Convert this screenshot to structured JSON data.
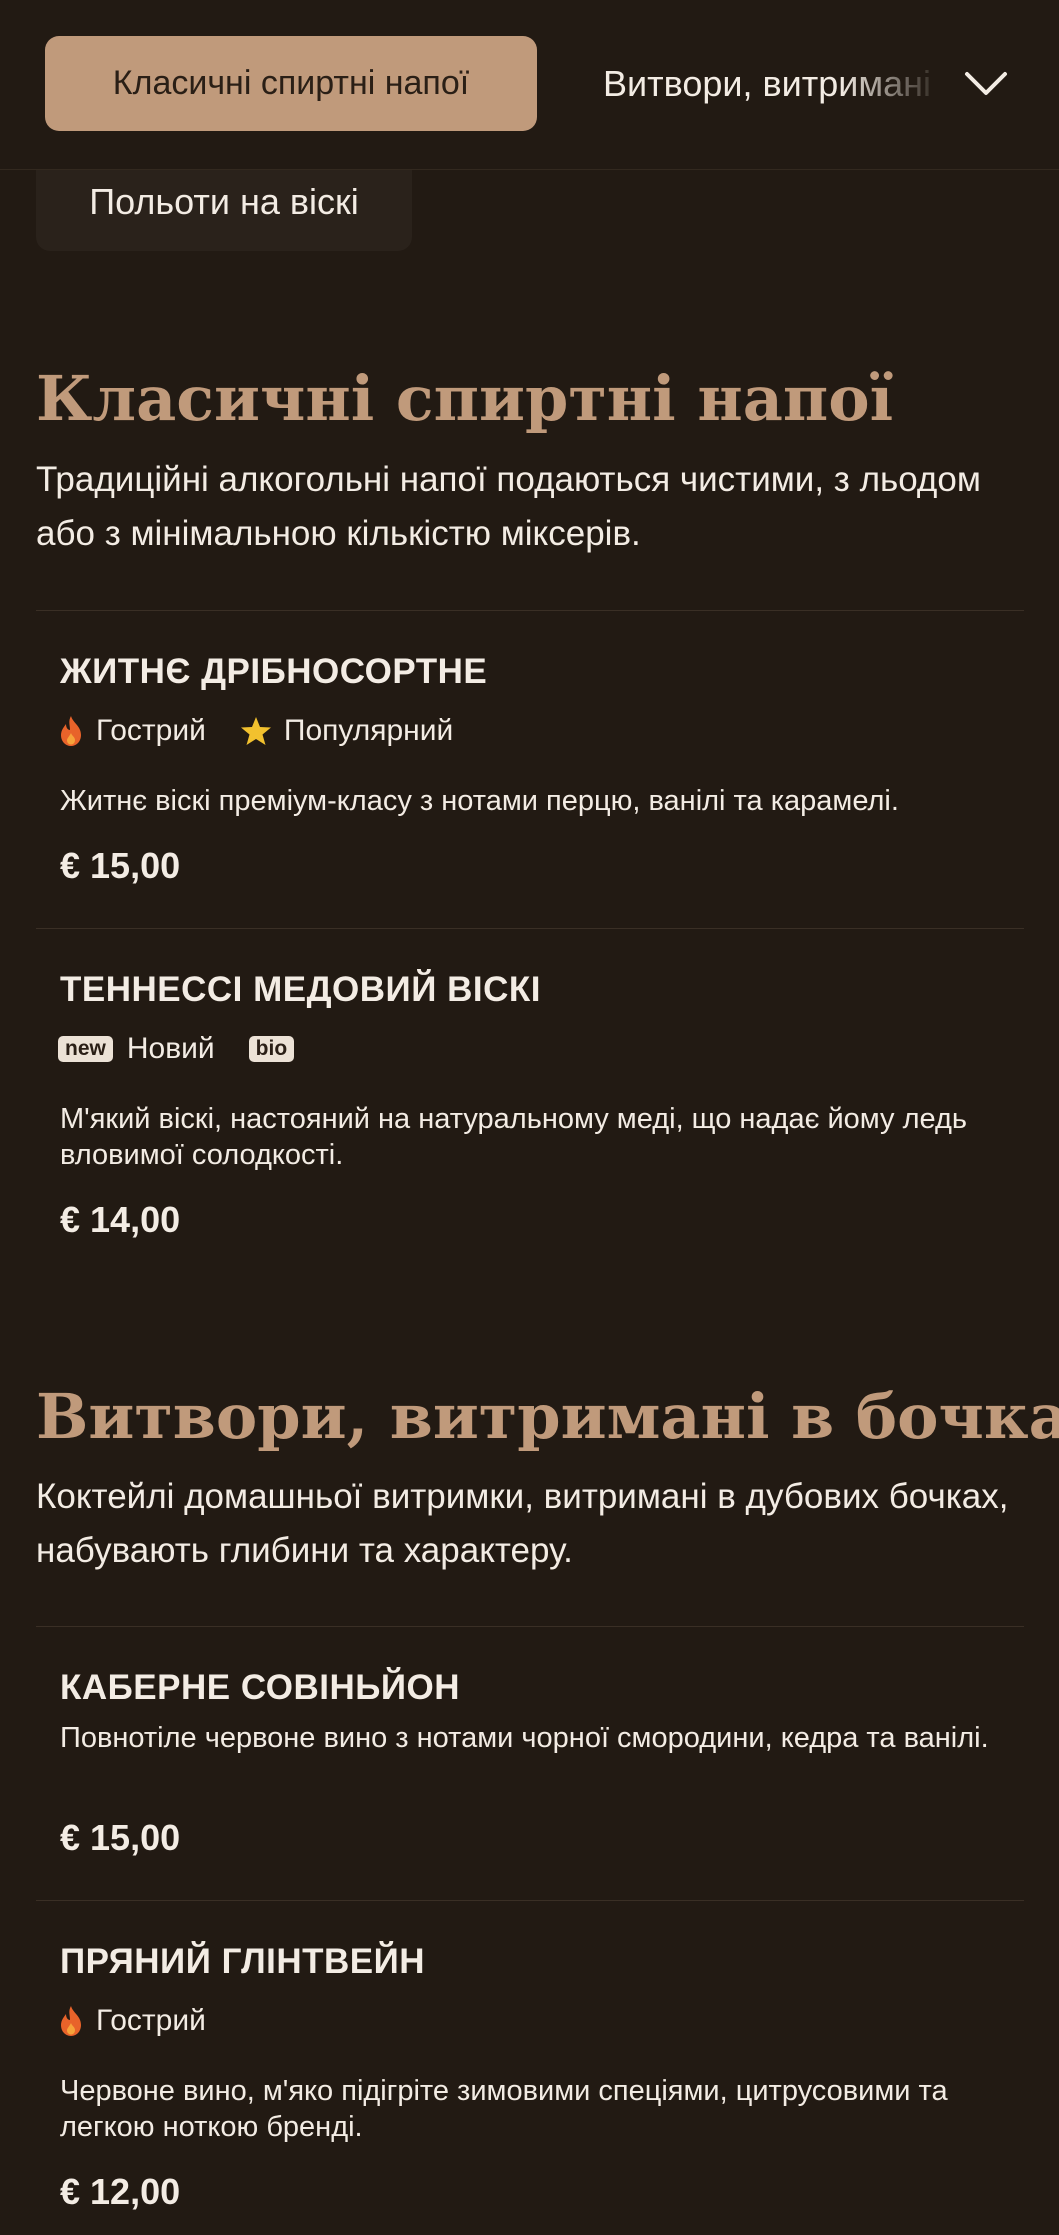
{
  "nav": {
    "active_chip": "Класичні спиртні напої",
    "next_chip": "Витвори, витримані в бочках",
    "row2_chip": "Польоти на віскі"
  },
  "colors": {
    "background": "#221a13",
    "accent": "#c09a7b",
    "text": "#f3ece4",
    "flame": "#e8632a",
    "star": "#f2c12e"
  },
  "sections": [
    {
      "title": "Класичні спиртні напої",
      "description": "Традиційні алкогольні напої подаються чистими, з льодом або з мінімальною кількістю міксерів.",
      "items": [
        {
          "name": "ЖИТНЄ ДРІБНОСОРТНЕ",
          "tags": [
            {
              "icon": "flame-icon",
              "label": "Гострий"
            },
            {
              "icon": "star-icon",
              "label": "Популярний"
            }
          ],
          "description": "Житнє віскі преміум-класу з нотами перцю, ванілі та карамелі.",
          "price": "€ 15,00"
        },
        {
          "name": "ТЕННЕССІ МЕДОВИЙ ВІСКІ",
          "tags": [
            {
              "badge": "new",
              "label": "Новий"
            },
            {
              "badge": "bio"
            }
          ],
          "description": "М'який віскі, настояний на натуральному меді, що надає йому ледь вловимої солодкості.",
          "price": "€ 14,00"
        }
      ]
    },
    {
      "title": "Витвори, витримані в бочках",
      "description": "Коктейлі домашньої витримки, витримані в дубових бочках, набувають глибини та характеру.",
      "items": [
        {
          "name": "КАБЕРНЕ СОВІНЬЙОН",
          "description": "Повнотіле червоне вино з нотами чорної смородини, кедра та ванілі.",
          "price": "€ 15,00"
        },
        {
          "name": "ПРЯНИЙ ГЛІНТВЕЙН",
          "tags": [
            {
              "icon": "flame-icon",
              "label": "Гострий"
            }
          ],
          "description": "Червоне вино, м'яко підігріте зимовими спеціями, цитрусовими та легкою ноткою бренді.",
          "price": "€ 12,00"
        }
      ]
    }
  ]
}
